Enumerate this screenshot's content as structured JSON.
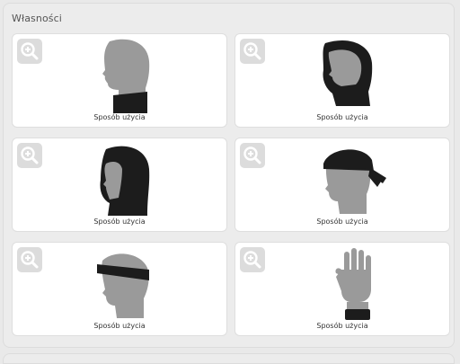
{
  "panel": {
    "title": "Własności"
  },
  "cards": [
    {
      "caption": "Sposób użycia",
      "illustration": "neck-gaiter-head-icon"
    },
    {
      "caption": "Sposób użycia",
      "illustration": "hood-balaclava-head-icon"
    },
    {
      "caption": "Sposób użycia",
      "illustration": "full-hood-head-icon"
    },
    {
      "caption": "Sposób użycia",
      "illustration": "bandana-cap-head-icon"
    },
    {
      "caption": "Sposób użycia",
      "illustration": "headband-head-icon"
    },
    {
      "caption": "Sposób użycia",
      "illustration": "wristband-hand-icon"
    }
  ],
  "colors": {
    "silhouette": "#9a9a9a",
    "garment": "#1c1c1c",
    "zoom_bg": "#dcdcdc",
    "zoom_fg": "#ffffff"
  }
}
